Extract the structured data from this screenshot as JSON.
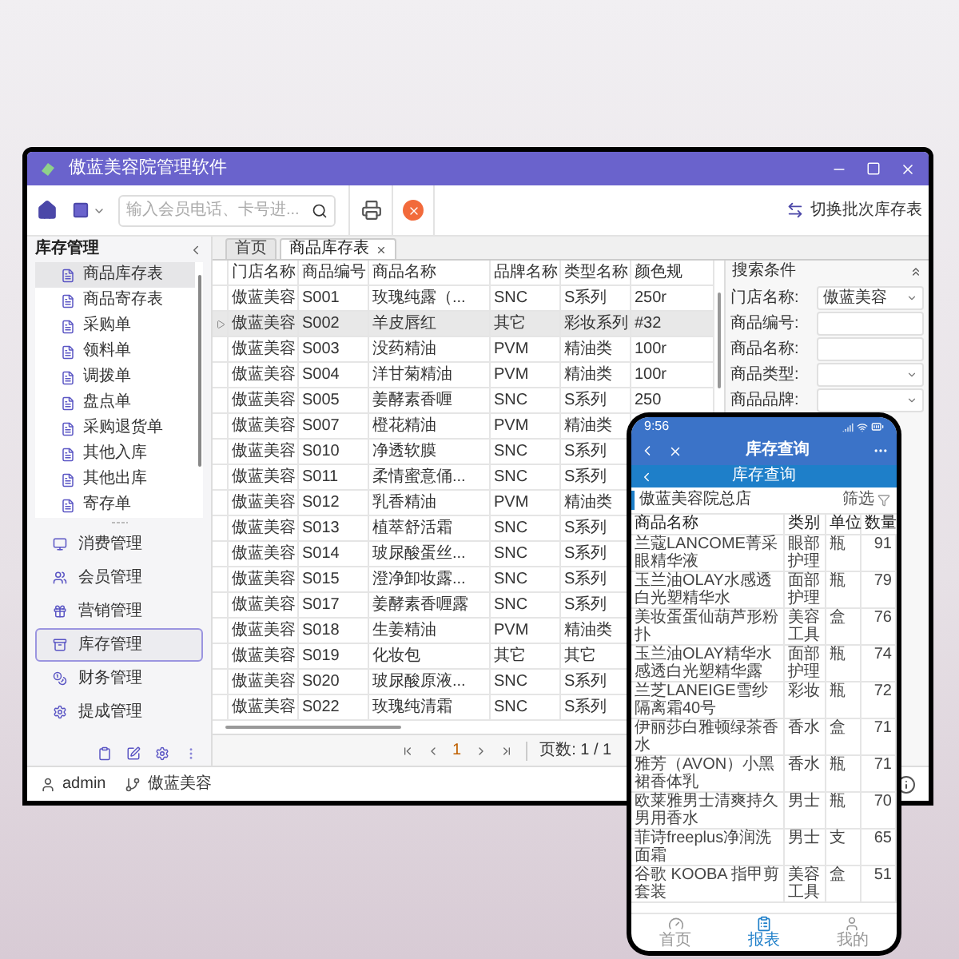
{
  "window": {
    "title": "傲蓝美容院管理软件"
  },
  "toolbar": {
    "search": {
      "placeholder": "输入会员电话、卡号进..."
    },
    "switch_label": "切换批次库存表"
  },
  "sidebar": {
    "title": "库存管理",
    "sub_items": [
      {
        "label": "商品库存表",
        "selected": true
      },
      {
        "label": "商品寄存表",
        "selected": false
      },
      {
        "label": "采购单",
        "selected": false
      },
      {
        "label": "领料单",
        "selected": false
      },
      {
        "label": "调拨单",
        "selected": false
      },
      {
        "label": "盘点单",
        "selected": false
      },
      {
        "label": "采购退货单",
        "selected": false
      },
      {
        "label": "其他入库",
        "selected": false
      },
      {
        "label": "其他出库",
        "selected": false
      },
      {
        "label": "寄存单",
        "selected": false
      }
    ],
    "nav_items": [
      {
        "label": "消费管理",
        "selected": false
      },
      {
        "label": "会员管理",
        "selected": false
      },
      {
        "label": "营销管理",
        "selected": false
      },
      {
        "label": "库存管理",
        "selected": true
      },
      {
        "label": "财务管理",
        "selected": false
      },
      {
        "label": "提成管理",
        "selected": false
      }
    ]
  },
  "tabs": [
    {
      "label": "首页",
      "selected": false,
      "closable": false
    },
    {
      "label": "商品库存表",
      "selected": true,
      "closable": true
    }
  ],
  "table": {
    "columns": [
      "门店名称",
      "商品编号",
      "商品名称",
      "品牌名称",
      "类型名称",
      "颜色规"
    ],
    "rows": [
      {
        "selected": false,
        "cells": [
          "傲蓝美容",
          "S001",
          "玫瑰纯露（...",
          "SNC",
          "S系列",
          "250r"
        ]
      },
      {
        "selected": true,
        "cells": [
          "傲蓝美容",
          "S002",
          "羊皮唇红",
          "其它",
          "彩妆系列",
          "#32"
        ]
      },
      {
        "selected": false,
        "cells": [
          "傲蓝美容",
          "S003",
          "没药精油",
          "PVM",
          "精油类",
          "100r"
        ]
      },
      {
        "selected": false,
        "cells": [
          "傲蓝美容",
          "S004",
          "洋甘菊精油",
          "PVM",
          "精油类",
          "100r"
        ]
      },
      {
        "selected": false,
        "cells": [
          "傲蓝美容",
          "S005",
          "姜酵素香喱",
          "SNC",
          "S系列",
          "250"
        ]
      },
      {
        "selected": false,
        "cells": [
          "傲蓝美容",
          "S007",
          "橙花精油",
          "PVM",
          "精油类"
        ]
      },
      {
        "selected": false,
        "cells": [
          "傲蓝美容",
          "S010",
          "净透软膜",
          "SNC",
          "S系列"
        ]
      },
      {
        "selected": false,
        "cells": [
          "傲蓝美容",
          "S011",
          "柔情蜜意俑...",
          "SNC",
          "S系列"
        ]
      },
      {
        "selected": false,
        "cells": [
          "傲蓝美容",
          "S012",
          "乳香精油",
          "PVM",
          "精油类"
        ]
      },
      {
        "selected": false,
        "cells": [
          "傲蓝美容",
          "S013",
          "植萃舒活霜",
          "SNC",
          "S系列"
        ]
      },
      {
        "selected": false,
        "cells": [
          "傲蓝美容",
          "S014",
          "玻尿酸蛋丝...",
          "SNC",
          "S系列"
        ]
      },
      {
        "selected": false,
        "cells": [
          "傲蓝美容",
          "S015",
          "澄净卸妆露...",
          "SNC",
          "S系列"
        ]
      },
      {
        "selected": false,
        "cells": [
          "傲蓝美容",
          "S017",
          "姜酵素香喱露",
          "SNC",
          "S系列"
        ]
      },
      {
        "selected": false,
        "cells": [
          "傲蓝美容",
          "S018",
          "生姜精油",
          "PVM",
          "精油类"
        ]
      },
      {
        "selected": false,
        "cells": [
          "傲蓝美容",
          "S019",
          "化妆包",
          "其它",
          "其它"
        ]
      },
      {
        "selected": false,
        "cells": [
          "傲蓝美容",
          "S020",
          "玻尿酸原液...",
          "SNC",
          "S系列"
        ]
      },
      {
        "selected": false,
        "cells": [
          "傲蓝美容",
          "S022",
          "玫瑰纯清霜",
          "SNC",
          "S系列"
        ]
      }
    ]
  },
  "pagination": {
    "page": "1",
    "pages": "页数: 1 / 1"
  },
  "search_panel": {
    "title": "搜索条件",
    "fields": [
      {
        "label": "门店名称:",
        "kind": "select",
        "value": "傲蓝美容"
      },
      {
        "label": "商品编号:",
        "kind": "text"
      },
      {
        "label": "商品名称:",
        "kind": "text"
      },
      {
        "label": "商品类型:",
        "kind": "select"
      },
      {
        "label": "商品品牌:",
        "kind": "select"
      }
    ]
  },
  "status_bar": {
    "user": "admin",
    "store": "傲蓝美容"
  },
  "phone": {
    "time": "9:56",
    "title": "库存查询",
    "subtitle": "库存查询",
    "store": "傲蓝美容院总店",
    "filter": "筛选",
    "columns": [
      "商品名称",
      "类别",
      "单位",
      "数量"
    ],
    "rows": [
      [
        "兰蔻LANCOME菁采眼精华液",
        "眼部护理",
        "瓶",
        "91"
      ],
      [
        "玉兰油OLAY水感透白光塑精华水",
        "面部护理",
        "瓶",
        "79"
      ],
      [
        "美妆蛋蛋仙葫芦形粉扑",
        "美容工具",
        "盒",
        "76"
      ],
      [
        "玉兰油OLAY精华水感透白光塑精华露",
        "面部护理",
        "瓶",
        "74"
      ],
      [
        "兰芝LANEIGE雪纱隔离霜40号",
        "彩妆",
        "瓶",
        "72"
      ],
      [
        "伊丽莎白雅顿绿茶香水",
        "香水",
        "盒",
        "71"
      ],
      [
        "雅芳（AVON）小黑裙香体乳",
        "香水",
        "瓶",
        "71"
      ],
      [
        "欧莱雅男士清爽持久男用香水",
        "男士",
        "瓶",
        "70"
      ],
      [
        "菲诗freeplus净润洗面霜",
        "男士",
        "支",
        "65"
      ],
      [
        "谷歌 KOOBA 指甲剪套装",
        "美容工具",
        "盒",
        "51"
      ]
    ],
    "nav": [
      {
        "label": "首页",
        "selected": false
      },
      {
        "label": "报表",
        "selected": true
      },
      {
        "label": "我的",
        "selected": false
      }
    ]
  }
}
